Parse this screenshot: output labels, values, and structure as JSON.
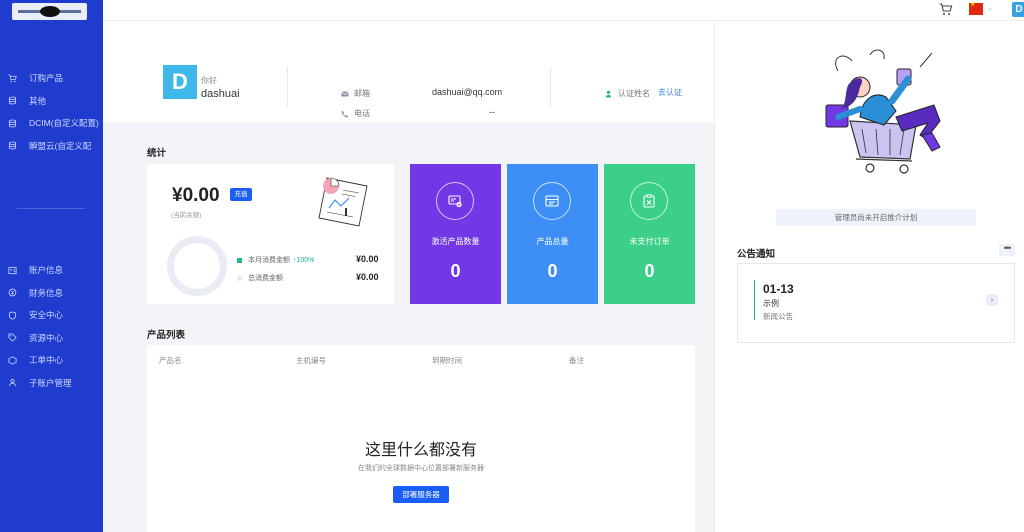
{
  "sidebar": {
    "logo_icon": "logo-image",
    "items": [
      {
        "label": "订购产品",
        "icon": "cart-icon"
      },
      {
        "label": "其他",
        "icon": "database-icon"
      },
      {
        "label": "DCIM(自定义配置)",
        "icon": "database-icon"
      },
      {
        "label": "瞬盟云(自定义配",
        "icon": "database-icon"
      }
    ],
    "account_items": [
      {
        "label": "账户信息",
        "icon": "user-card-icon"
      },
      {
        "label": "财务信息",
        "icon": "finance-icon"
      },
      {
        "label": "安全中心",
        "icon": "shield-icon"
      },
      {
        "label": "资源中心",
        "icon": "tag-icon"
      },
      {
        "label": "工单中心",
        "icon": "ticket-icon"
      },
      {
        "label": "子账户管理",
        "icon": "sub-account-icon"
      }
    ]
  },
  "topbar": {
    "avatar_letter": "D"
  },
  "profile": {
    "avatar_letter": "D",
    "greeting": "你好",
    "username": "dashuai",
    "email_label": "邮箱",
    "email_value": "dashuai@qq.com",
    "phone_label": "电话",
    "phone_value": "--",
    "verify_label": "认证姓名",
    "verify_link": "去认证"
  },
  "stats": {
    "title": "统计",
    "balance": "¥0.00",
    "recharge": "充值",
    "balance_sub": "(当前余额)",
    "month_label": "本月消费金额",
    "month_pct": "↑100%",
    "month_value": "¥0.00",
    "total_label": "总消费金额",
    "total_value": "¥0.00",
    "tiles": [
      {
        "label": "激活产品数量",
        "value": "0",
        "color": "#7338e6",
        "icon": "active-product-icon"
      },
      {
        "label": "产品总量",
        "value": "0",
        "color": "#3d8ff6",
        "icon": "product-total-icon"
      },
      {
        "label": "未支付订单",
        "value": "0",
        "color": "#3ccf8a",
        "icon": "unpaid-order-icon"
      }
    ]
  },
  "products": {
    "title": "产品列表",
    "columns": [
      "产品名",
      "主机编号",
      "到期时间",
      "备注"
    ],
    "empty_title": "这里什么都没有",
    "empty_sub": "在我们的全球数据中心位置部署新服务器",
    "deploy_button": "部署服务器"
  },
  "right": {
    "promo_text": "管理员尚未开启推介计划",
    "notice_title": "公告通知",
    "notice": {
      "date": "01-13",
      "name": "示例",
      "category": "新闻公告"
    }
  },
  "colors": {
    "sidebar": "#1f3ccf",
    "accent": "#1a5ef5",
    "success": "#1fb48a"
  }
}
